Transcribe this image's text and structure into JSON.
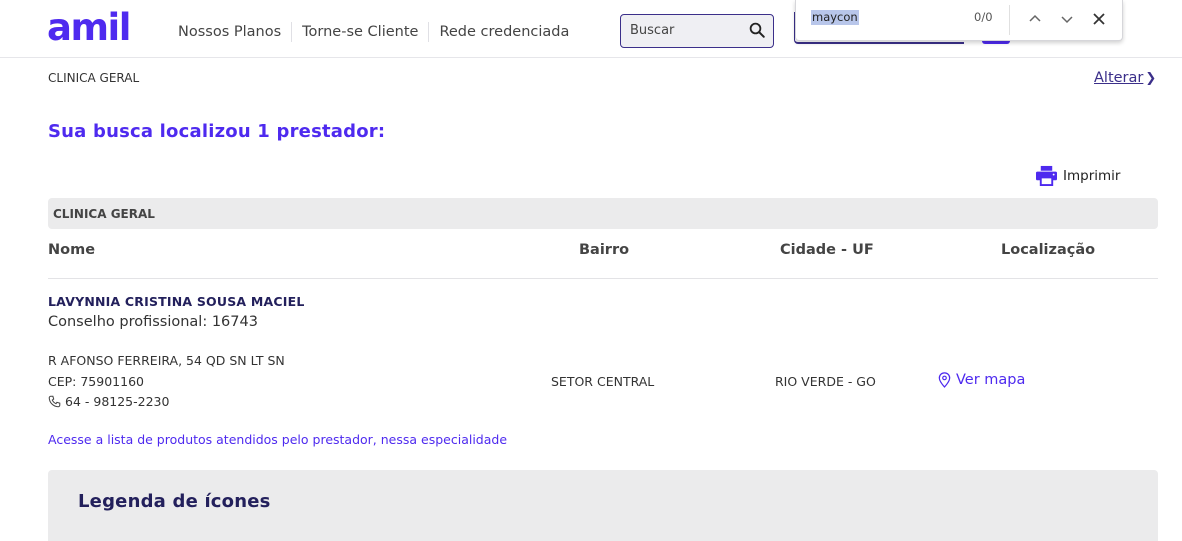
{
  "header": {
    "logo": "amil",
    "nav": [
      "Nossos Planos",
      "Torne-se Cliente",
      "Rede credenciada"
    ],
    "search_placeholder": "Buscar"
  },
  "find_bar": {
    "term": "maycon",
    "count": "0/0"
  },
  "filter": {
    "specialty": "CLINICA GERAL",
    "change_link": "Alterar"
  },
  "results": {
    "title": "Sua busca localizou 1 prestador:",
    "print_label": "Imprimir",
    "section": "CLINICA GERAL",
    "columns": {
      "name": "Nome",
      "neighborhood": "Bairro",
      "city": "Cidade - UF",
      "location": "Localização"
    },
    "provider": {
      "name": "LAVYNNIA CRISTINA SOUSA MACIEL",
      "council": "Conselho profissional: 16743",
      "address": "R AFONSO FERREIRA, 54 QD SN LT SN",
      "cep": "CEP: 75901160",
      "phone": "64 - 98125-2230",
      "neighborhood": "SETOR CENTRAL",
      "city": "RIO VERDE - GO",
      "map_link": "Ver mapa",
      "products_link": "Acesse a lista de produtos atendidos pelo prestador, nessa especialidade"
    }
  },
  "legend": {
    "title": "Legenda de ícones"
  },
  "colors": {
    "brand": "#4e2aef",
    "dark": "#23205c",
    "panel": "#ebebec"
  }
}
